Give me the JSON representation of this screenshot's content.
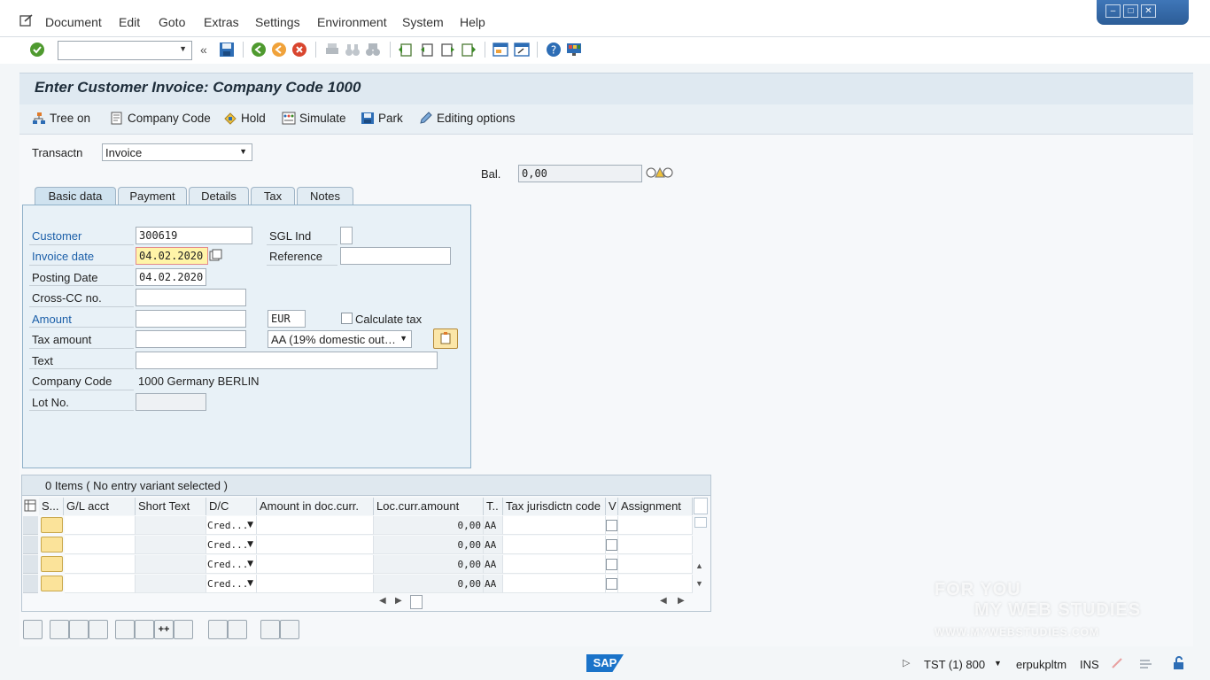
{
  "menu": [
    "Document",
    "Edit",
    "Goto",
    "Extras",
    "Settings",
    "Environment",
    "System",
    "Help"
  ],
  "title": "Enter Customer Invoice: Company Code 1000",
  "appbar": {
    "tree_on": "Tree on",
    "company_code": "Company Code",
    "hold": "Hold",
    "simulate": "Simulate",
    "park": "Park",
    "editing_options": "Editing options"
  },
  "transaction": {
    "label": "Transactn",
    "value": "Invoice"
  },
  "balance": {
    "label": "Bal.",
    "value": "0,00"
  },
  "tabs": [
    "Basic data",
    "Payment",
    "Details",
    "Tax",
    "Notes"
  ],
  "form": {
    "customer_label": "Customer",
    "customer_value": "300619",
    "sgl_label": "SGL Ind",
    "invoice_date_label": "Invoice date",
    "invoice_date_value": "04.02.2020",
    "reference_label": "Reference",
    "posting_date_label": "Posting Date",
    "posting_date_value": "04.02.2020",
    "crosscc_label": "Cross-CC no.",
    "amount_label": "Amount",
    "currency_value": "EUR",
    "calc_tax_label": "Calculate tax",
    "tax_amount_label": "Tax amount",
    "tax_code_value": "AA (19% domestic out…",
    "text_label": "Text",
    "company_code_label": "Company Code",
    "company_code_value": "1000 Germany BERLIN",
    "lot_label": "Lot No."
  },
  "grid": {
    "summary": "0 Items ( No entry variant selected )",
    "headers": [
      "S...",
      "G/L acct",
      "Short Text",
      "D/C",
      "Amount in doc.curr.",
      "Loc.curr.amount",
      "T..",
      "Tax jurisdictn code",
      "V",
      "Assignment"
    ],
    "rows": [
      {
        "dc": "Cred...",
        "loc": "0,00",
        "tax": "AA"
      },
      {
        "dc": "Cred...",
        "loc": "0,00",
        "tax": "AA"
      },
      {
        "dc": "Cred...",
        "loc": "0,00",
        "tax": "AA"
      },
      {
        "dc": "Cred...",
        "loc": "0,00",
        "tax": "AA"
      }
    ]
  },
  "status": {
    "logo": "SAP",
    "system": "TST (1) 800",
    "server": "erpukpltm",
    "mode": "INS"
  },
  "watermark": {
    "line1": "FOR YOU",
    "line2": "MY WEB STUDIES",
    "line3": "WWW.MYWEBSTUDIES.COM"
  },
  "colors": {
    "accent": "#1a5ea8",
    "header_bg": "#dfe9f1",
    "highlight": "#fff4a8"
  }
}
